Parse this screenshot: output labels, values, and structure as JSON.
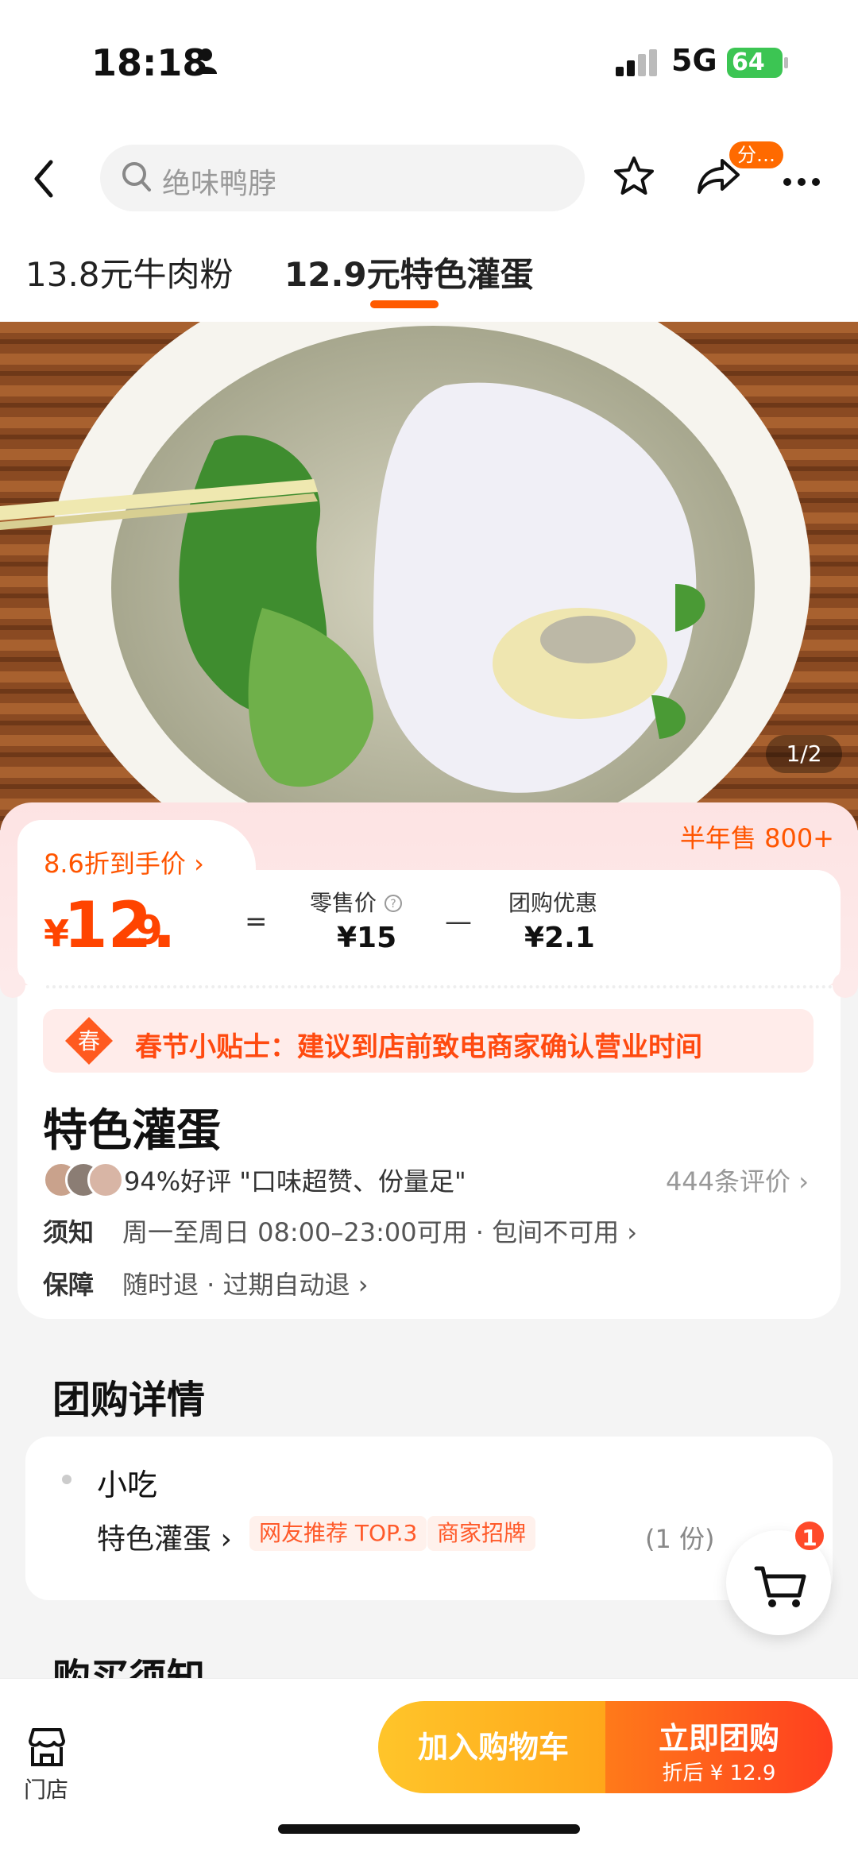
{
  "status_bar": {
    "time": "18:18",
    "network": "5G",
    "battery": "64"
  },
  "top_bar": {
    "search_placeholder": "绝味鸭脖",
    "share_badge": "分…"
  },
  "tabs": [
    {
      "label": "13.8元牛肉粉"
    },
    {
      "label": "12.9元特色灌蛋"
    }
  ],
  "gallery": {
    "page_indicator": "1/2"
  },
  "price": {
    "discount_label": "8.6折到手价 ›",
    "sold": "半年售 800+",
    "currency": "¥",
    "integer": "12.",
    "decimal": "9",
    "equals": "=",
    "retail_label": "零售价",
    "retail_value": "¥15",
    "minus": "—",
    "group_label": "团购优惠",
    "group_value": "¥2.1"
  },
  "info": {
    "tip_icon_char": "春",
    "tip": "春节小贴士：建议到店前致电商家确认营业时间",
    "title": "特色灌蛋",
    "rating": "94%好评  \"口味超赞、份量足\"",
    "reviews": "444条评价 ›",
    "notice_label": "须知",
    "notice_text": "周一至周日 08:00–23:00可用 · 包间不可用 ›",
    "guarantee_label": "保障",
    "guarantee_text": "随时退 · 过期自动退 ›"
  },
  "detail": {
    "section_title": "团购详情",
    "category": "小吃",
    "item_name": "特色灌蛋 ›",
    "tags": [
      "网友推荐 TOP.3",
      "商家招牌"
    ],
    "qty": "(1 份)"
  },
  "notice_section": {
    "title": "购买须知"
  },
  "cart": {
    "count": "1"
  },
  "bottom_bar": {
    "store_label": "门店",
    "add_cart": "加入购物车",
    "buy_now": "立即团购",
    "buy_sub": "折后 ¥ 12.9"
  },
  "colors": {
    "accent": "#ff5500",
    "price": "#ff4400",
    "cart_btn": "#ffb020",
    "buy_btn": "#ff4a1f"
  }
}
